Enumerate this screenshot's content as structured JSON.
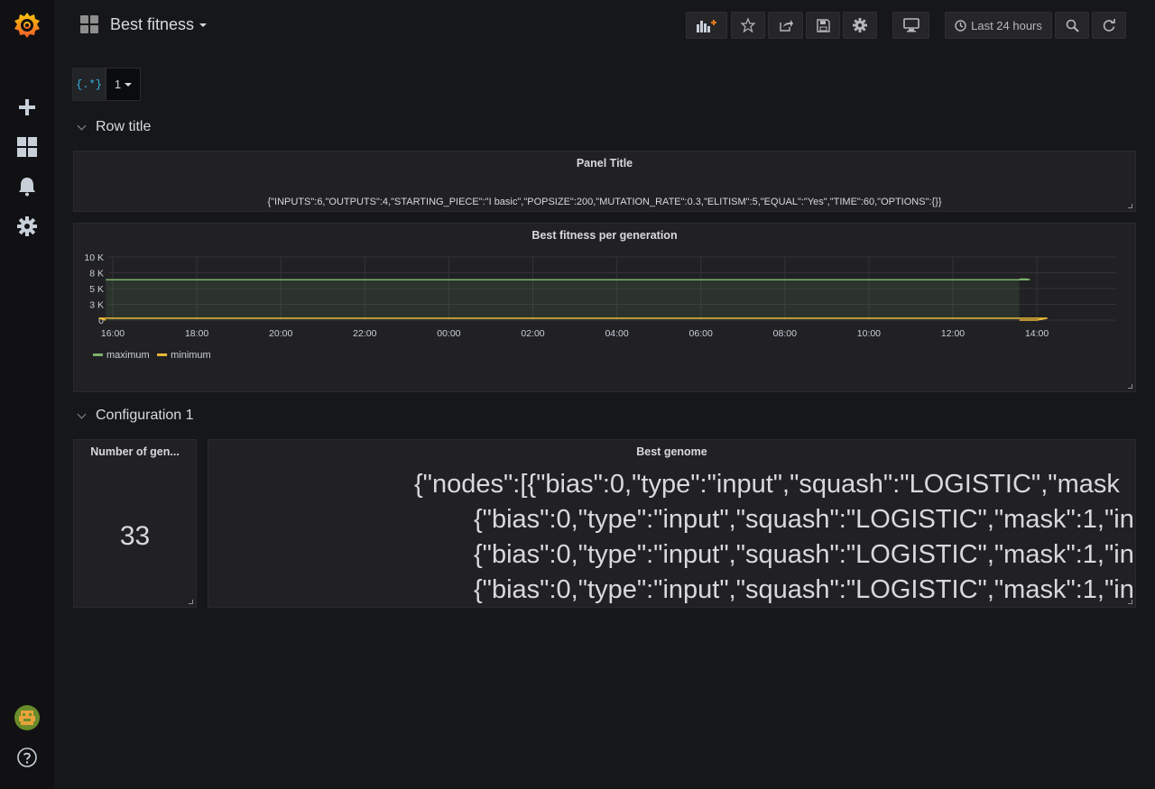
{
  "dashboard": {
    "title": "Best fitness"
  },
  "toolbar": {
    "time_range_label": "Last 24 hours"
  },
  "variables": {
    "regex_label": "{.*}",
    "value": "1"
  },
  "rows": [
    {
      "title": "Row title"
    },
    {
      "title": "Configuration 1"
    }
  ],
  "panels": {
    "text_panel": {
      "title": "Panel Title",
      "content": "{\"INPUTS\":6,\"OUTPUTS\":4,\"STARTING_PIECE\":\"I basic\",\"POPSIZE\":200,\"MUTATION_RATE\":0.3,\"ELITISM\":5,\"EQUAL\":\"Yes\",\"TIME\":60,\"OPTIONS\":{}}"
    },
    "graph_panel": {
      "title": "Best fitness per generation"
    },
    "stat_panel": {
      "title": "Number of gen...",
      "value": "33"
    },
    "genome_panel": {
      "title": "Best genome",
      "lines": [
        "{\"nodes\":[{\"bias\":0,\"type\":\"input\",\"squash\":\"LOGISTIC\",\"mask",
        "{\"bias\":0,\"type\":\"input\",\"squash\":\"LOGISTIC\",\"mask\":1,\"in",
        "{\"bias\":0,\"type\":\"input\",\"squash\":\"LOGISTIC\",\"mask\":1,\"in",
        "{\"bias\":0,\"type\":\"input\",\"squash\":\"LOGISTIC\",\"mask\":1,\"in"
      ]
    }
  },
  "colors": {
    "maximum": "#7eb26d",
    "minimum": "#eab839",
    "accent": "#33b5e5"
  },
  "chart_data": {
    "type": "line",
    "title": "Best fitness per generation",
    "xlabel": "",
    "ylabel": "",
    "x_ticks": [
      "16:00",
      "18:00",
      "20:00",
      "22:00",
      "00:00",
      "02:00",
      "04:00",
      "06:00",
      "08:00",
      "10:00",
      "12:00",
      "14:00"
    ],
    "y_ticks": [
      "0",
      "3 K",
      "5 K",
      "8 K",
      "10 K"
    ],
    "ylim": [
      0,
      10000
    ],
    "xlim": [
      "15:10",
      "15:50"
    ],
    "grid": true,
    "legend_position": "bottom-left",
    "series": [
      {
        "name": "maximum",
        "color": "#7eb26d",
        "fill": true,
        "points": [
          [
            "13:35",
            6500
          ],
          [
            "13:45",
            6500
          ],
          [
            "13:50",
            6400
          ],
          [
            "15:50",
            6400
          ]
        ]
      },
      {
        "name": "minimum",
        "color": "#eab839",
        "fill": false,
        "points": [
          [
            "13:35",
            0
          ],
          [
            "14:00",
            0
          ],
          [
            "14:15",
            300
          ],
          [
            "15:40",
            300
          ],
          [
            "15:50",
            0
          ]
        ]
      }
    ]
  }
}
